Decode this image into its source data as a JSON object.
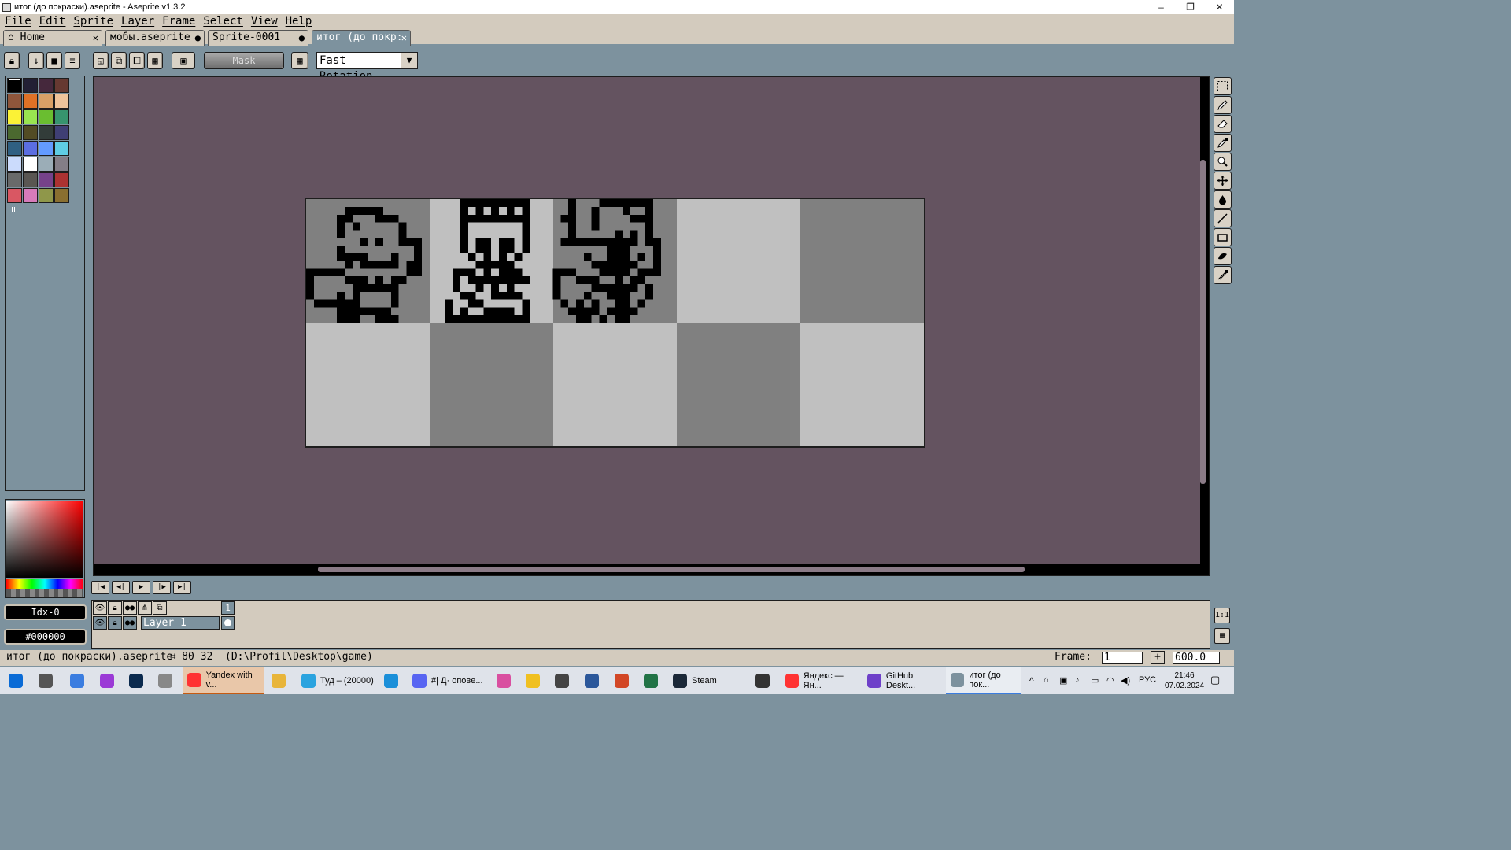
{
  "window": {
    "title": "итог (до покраски).aseprite - Aseprite v1.3.2",
    "minimize_glyph": "–",
    "restore_glyph": "❐",
    "close_glyph": "✕"
  },
  "menu": [
    "File",
    "Edit",
    "Sprite",
    "Layer",
    "Frame",
    "Select",
    "View",
    "Help"
  ],
  "tabs": [
    {
      "label": "Home",
      "marker": "✕"
    },
    {
      "label": "мобы.aseprite",
      "marker": "●"
    },
    {
      "label": "Sprite-0001",
      "marker": "●"
    },
    {
      "label": "итог (до покр:",
      "marker": "✕"
    }
  ],
  "toolbar": {
    "mask_label": "Mask",
    "rotation_algorithm": "Fast Rotation"
  },
  "palette": [
    "#000000",
    "#222034",
    "#45283c",
    "#663931",
    "#8f563b",
    "#df7126",
    "#d9a066",
    "#eec39a",
    "#fbf236",
    "#99e550",
    "#6abe30",
    "#37946e",
    "#4b692f",
    "#524b24",
    "#323c39",
    "#3f3f74",
    "#306082",
    "#5b6ee1",
    "#639bff",
    "#5fcde4",
    "#cbdbfc",
    "#ffffff",
    "#9badb7",
    "#847e87",
    "#696a6a",
    "#595652",
    "#76428a",
    "#ac3232",
    "#d95763",
    "#d77bba",
    "#8f974a",
    "#8a6f30"
  ],
  "color": {
    "index_label": "Idx-0",
    "hex_label": "#000000"
  },
  "timeline": {
    "layer_name": "Layer 1",
    "frame_number": "1"
  },
  "status": {
    "file_name": "итог (до покраски).aseprite",
    "sprite_size": "80 32",
    "path": "(D:\\Profil\\Desktop\\game)",
    "frame_label": "Frame:",
    "frame_value": "1",
    "zoom_value": "600.0"
  },
  "taskbar": {
    "apps": [
      {
        "label": "Yandex with v...",
        "color": "#ff3333"
      },
      {
        "label": "Туд – (20000)",
        "color": "#2aa3df"
      },
      {
        "label": "#| Д· оповe...",
        "color": "#5865f2"
      },
      {
        "label": "Steam",
        "color": "#1b2838"
      },
      {
        "label": "Яндекс — Ян...",
        "color": "#ff3333"
      },
      {
        "label": "GitHub Deskt...",
        "color": "#6e40c9"
      },
      {
        "label": "итог (до пок...",
        "color": "#7d929e"
      }
    ],
    "lang": "РУС",
    "time": "21:46",
    "date": "07.02.2024"
  },
  "colors": {
    "accent": "#7d929e",
    "canvas_bg": "#645360",
    "panel": "#d3cbbe"
  }
}
